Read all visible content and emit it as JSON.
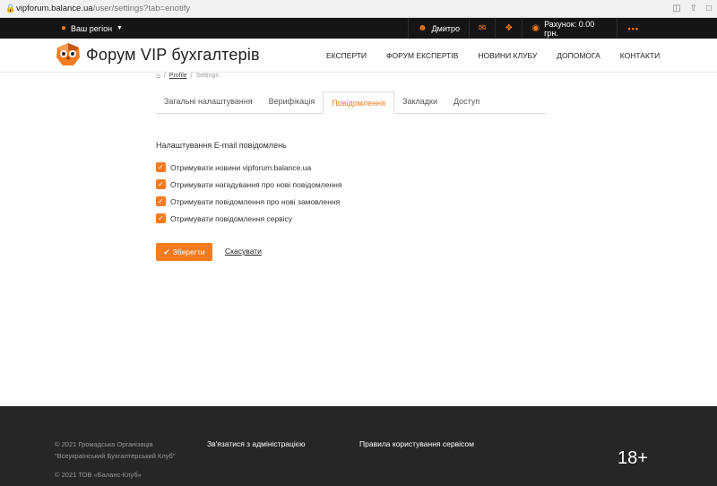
{
  "browser": {
    "url_host": "vipforum.balance.ua",
    "url_path": "/user/settings?tab=enotify",
    "icons": [
      "translate-icon",
      "share-icon",
      "extension-icon"
    ]
  },
  "topbar": {
    "region_label": "Ваш регіон",
    "user_name": "Дмитро",
    "account_label": "Рахунок:  0.00 грн.",
    "more_label": "•••"
  },
  "header": {
    "logo_text": "Форум VIP бухгалтерів",
    "nav": [
      "ЕКСПЕРТИ",
      "ФОРУМ ЕКСПЕРТІВ",
      "НОВИНИ КЛУБУ",
      "ДОПОМОГА",
      "КОНТАКТИ"
    ]
  },
  "breadcrumb": {
    "sep": "/",
    "profile": "Profile",
    "current": "Settings"
  },
  "tabs": [
    {
      "label": "Загальні налаштування",
      "active": false
    },
    {
      "label": "Верифікація",
      "active": false
    },
    {
      "label": "Повідомлення",
      "active": true
    },
    {
      "label": "Закладки",
      "active": false
    },
    {
      "label": "Доступ",
      "active": false
    }
  ],
  "email_settings": {
    "title": "Налаштування E-mail повідомлень",
    "options": [
      {
        "label": "Отримувати новини vipforum.balance.ua",
        "checked": true
      },
      {
        "label": "Отримувати нагадування про нові повідомлення",
        "checked": true
      },
      {
        "label": "Отримувати повідомлення про нові замовлення",
        "checked": true
      },
      {
        "label": "Отримувати повідомлення сервісу",
        "checked": true
      }
    ]
  },
  "actions": {
    "save": "Зберегти",
    "cancel": "Скасувати"
  },
  "footer": {
    "copyright1": "© 2021 Громадська Організація \"Всеукраїнський Бухгалтерський Клуб\"",
    "copyright2": "© 2021 ТОВ «Баланс-Клуб»",
    "contact_admin": "Зв'язатися з адміністрацією",
    "terms": "Правила користування сервісом",
    "age": "18+"
  },
  "colors": {
    "accent": "#f47b20",
    "topbar": "#151515",
    "footer": "#262626"
  }
}
